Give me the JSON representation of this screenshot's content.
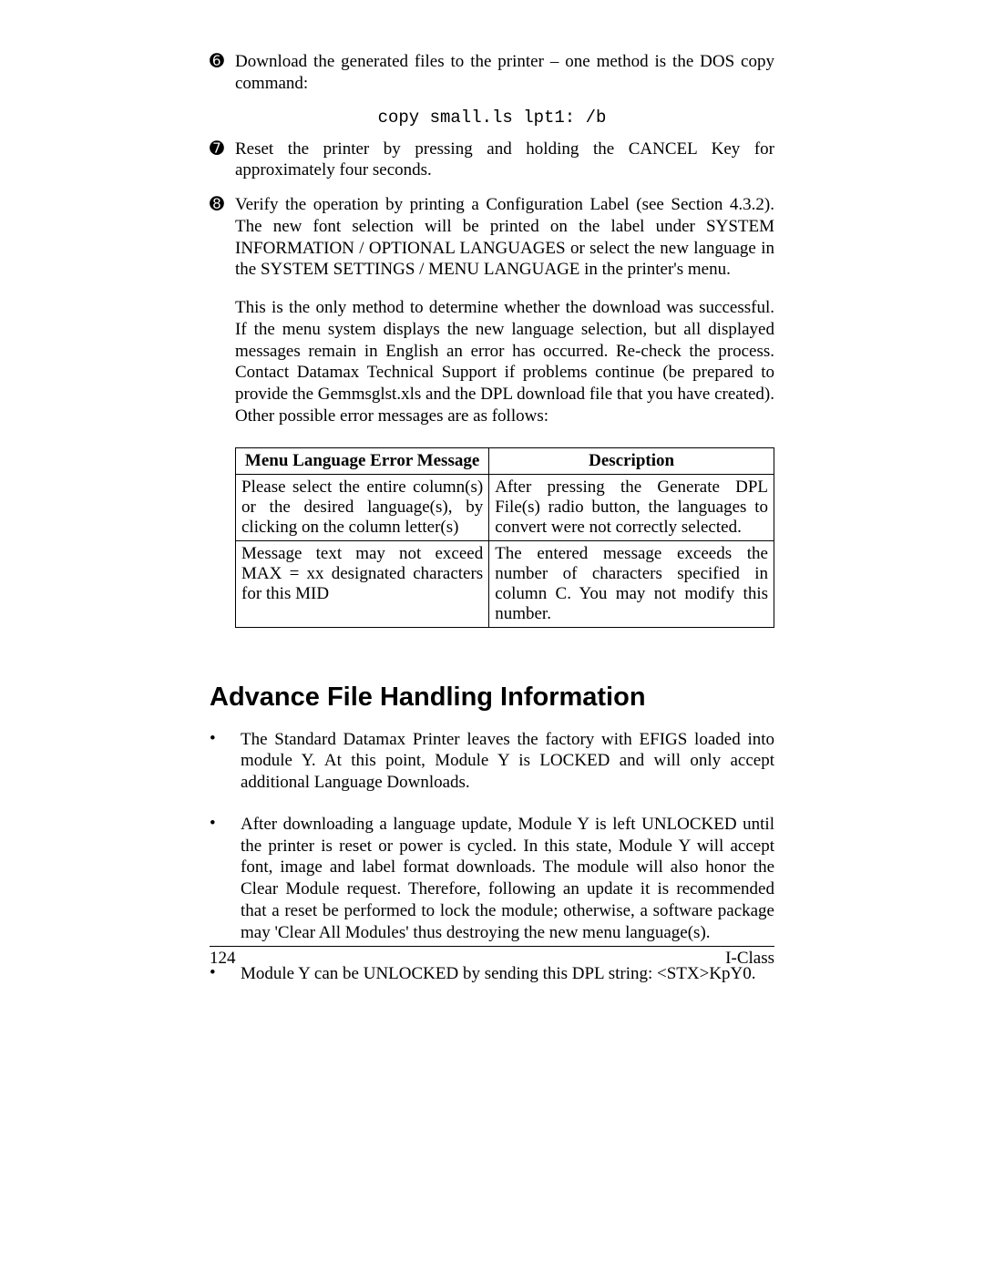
{
  "steps": {
    "s6": {
      "mark": "➏",
      "text": "Download the generated files to the printer – one method is the DOS copy command:"
    },
    "code": "copy small.ls lpt1: /b",
    "s7": {
      "mark": "➐",
      "text": "Reset the printer by pressing and holding the CANCEL Key for approximately four seconds."
    },
    "s8": {
      "mark": "➑",
      "text": "Verify the operation by printing a Configuration Label (see Section 4.3.2). The new font selection will be printed on the label under SYSTEM INFORMATION / OPTIONAL LANGUAGES or select the new language in the SYSTEM SETTINGS / MENU LANGUAGE in the printer's menu."
    }
  },
  "followup": "This is the only method to determine whether the download was successful. If the menu system displays the new language selection, but all displayed messages remain in English an error has occurred. Re-check the process. Contact Datamax Technical Support if problems continue (be prepared to provide the Gemmsglst.xls and the DPL download file that you have created). Other possible error messages are as follows:",
  "table": {
    "head": {
      "c1": "Menu Language Error Message",
      "c2": "Description"
    },
    "rows": [
      {
        "c1": "Please select the entire column(s) or the desired language(s), by clicking on the column letter(s)",
        "c2": "After pressing the Generate DPL File(s) radio button, the languages to convert were not correctly selected."
      },
      {
        "c1": "Message text may not exceed MAX = xx designated characters for this MID",
        "c2": "The entered message exceeds the number of characters specified in column C. You may not modify this number."
      }
    ]
  },
  "section_title": "Advance File Handling Information",
  "bullets": [
    "The Standard Datamax Printer leaves the factory with EFIGS loaded into module Y. At this point, Module Y is LOCKED and will only accept additional Language Downloads.",
    "After downloading a language update, Module Y is left UNLOCKED until the printer is reset or power is cycled. In this state, Module Y will accept font, image and label format downloads. The module will also honor the Clear Module request. Therefore, following an update it is recommended that a reset be performed to lock the module; otherwise, a software package may 'Clear All Modules' thus destroying the new menu language(s).",
    "Module Y can be UNLOCKED by sending this DPL string:   <STX>KpY0."
  ],
  "footer": {
    "left": "124",
    "right": "I-Class"
  }
}
